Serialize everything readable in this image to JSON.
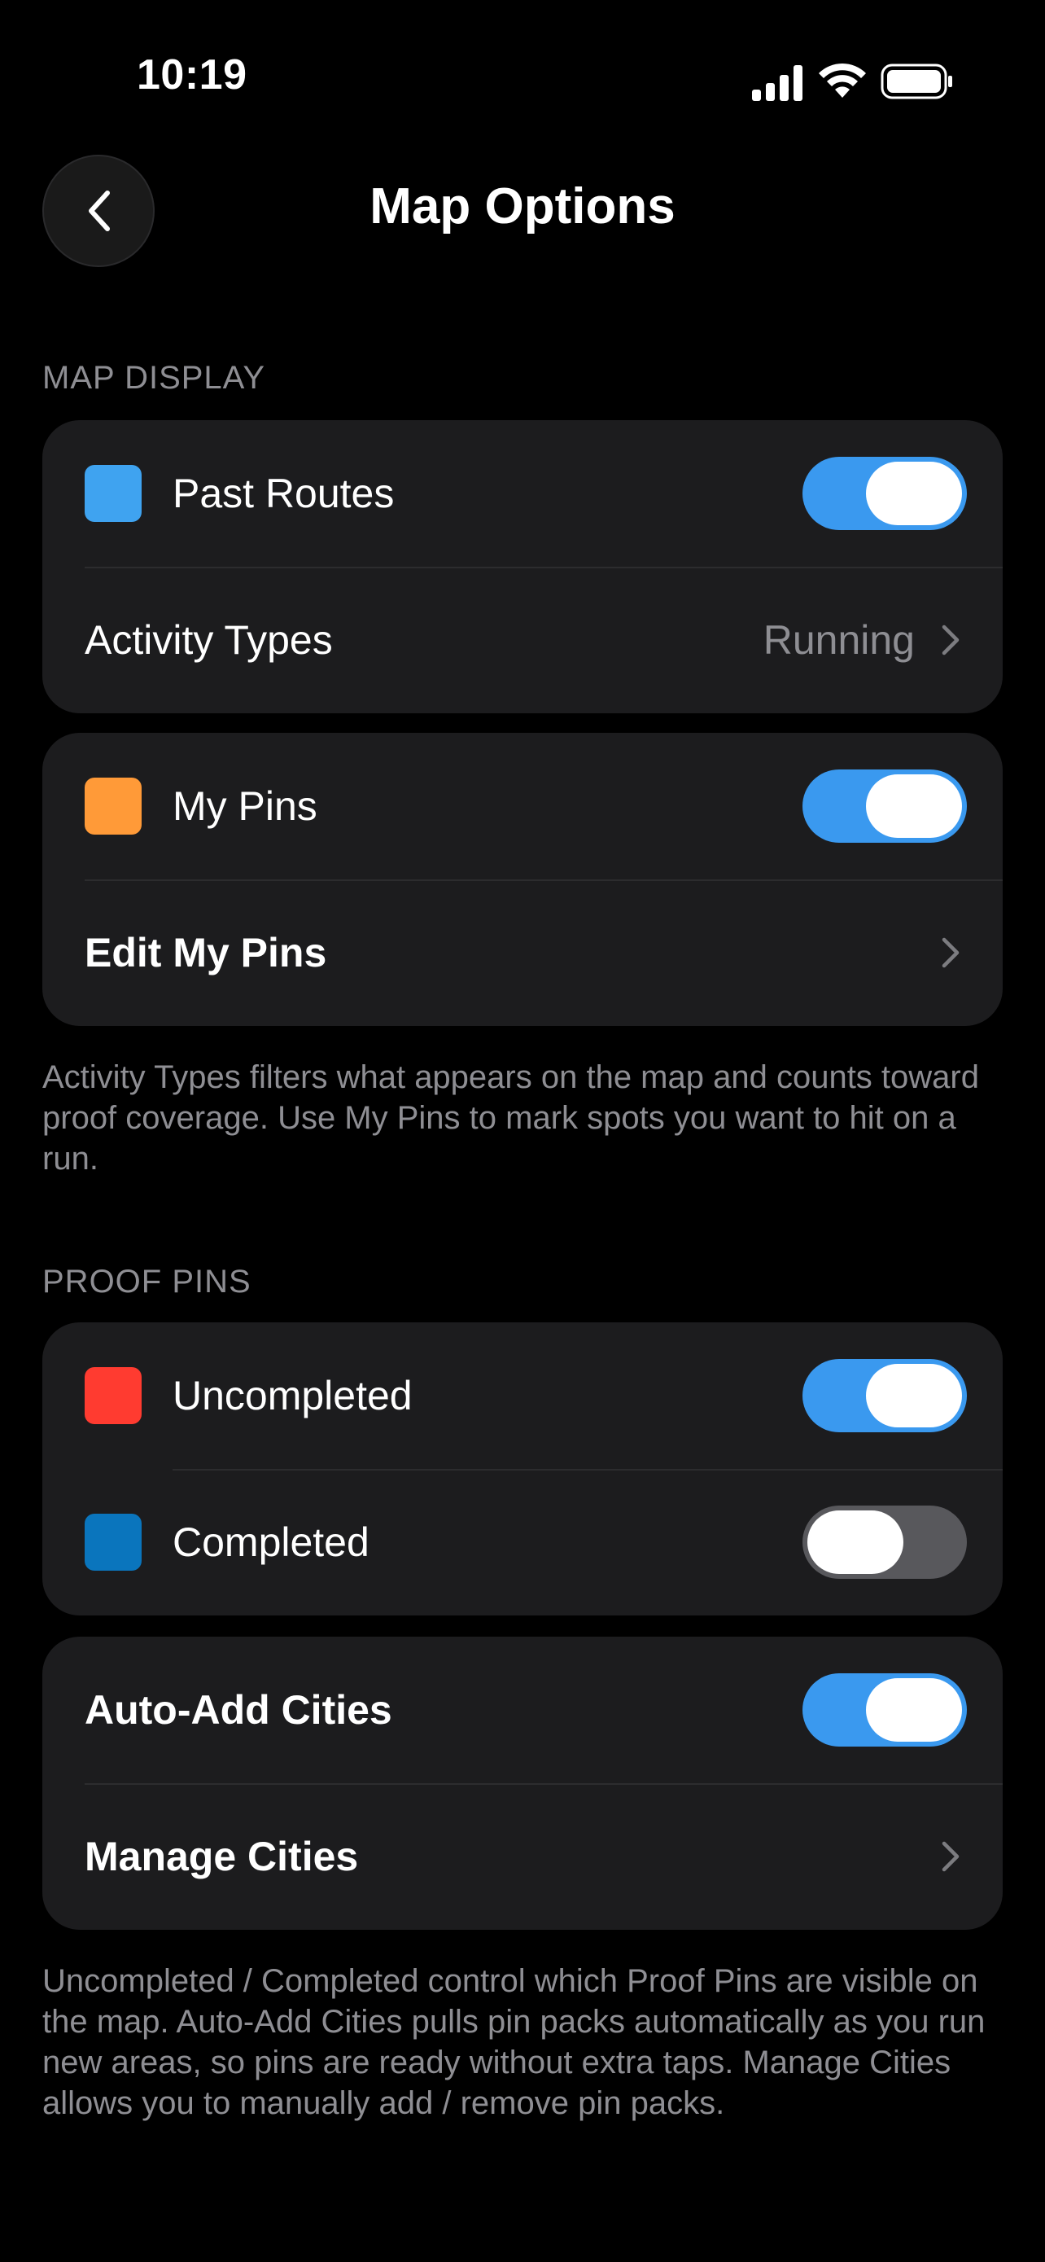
{
  "status_bar": {
    "time": "10:19",
    "icons": [
      "cellular-signal-icon",
      "wifi-icon",
      "battery-icon"
    ]
  },
  "nav": {
    "back_icon": "chevron-left-icon",
    "title": "Map Options"
  },
  "sections": {
    "map_display": {
      "header": "MAP DISPLAY",
      "past_routes": {
        "label": "Past Routes",
        "swatch_color": "#3fa3f0",
        "toggle_on": true
      },
      "activity_types": {
        "label": "Activity Types",
        "value": "Running"
      },
      "my_pins": {
        "label": "My Pins",
        "swatch_color": "#ff9a38",
        "toggle_on": true
      },
      "edit_my_pins": {
        "label": "Edit My Pins"
      },
      "footnote": "Activity Types filters what appears on the map and counts toward proof coverage. Use My Pins to mark spots you want to hit on a run."
    },
    "proof_pins": {
      "header": "PROOF PINS",
      "uncompleted": {
        "label": "Uncompleted",
        "swatch_color": "#ff3b30",
        "toggle_on": true
      },
      "completed": {
        "label": "Completed",
        "swatch_color": "#0a75bd",
        "toggle_on": false
      },
      "auto_add_cities": {
        "label": "Auto-Add Cities",
        "toggle_on": true
      },
      "manage_cities": {
        "label": "Manage Cities"
      },
      "footnote": "Uncompleted / Completed control which Proof Pins are visible on the map. Auto-Add Cities pulls pin packs automatically as you run new areas, so pins are ready without extra taps. Manage Cities allows you to manually add / remove pin packs."
    }
  },
  "colors": {
    "background": "#000000",
    "card": "#1c1c1e",
    "toggle_on": "#3a99ef",
    "toggle_off": "#58585c",
    "secondary_text": "#8e8e93"
  }
}
